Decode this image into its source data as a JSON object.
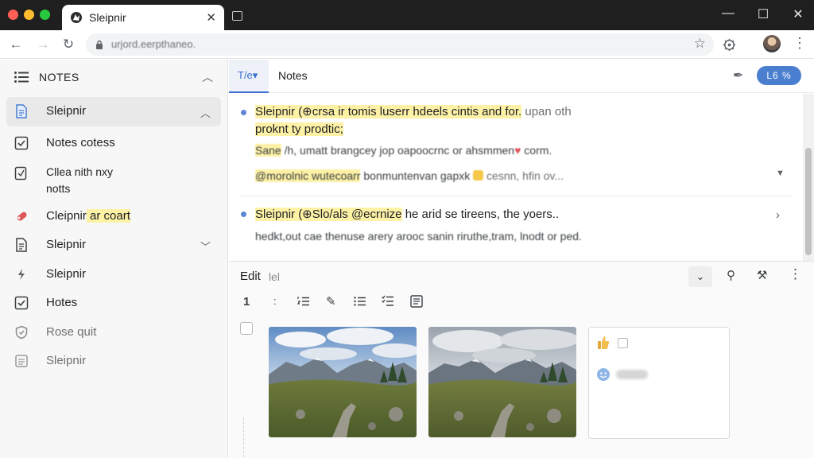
{
  "browser": {
    "tab_title": "Sleipnir",
    "tab_close": "✕",
    "url": "urjord.eerpthaneo.",
    "window_controls": [
      "—",
      "☐",
      "✕"
    ]
  },
  "sidebar": {
    "header": "NOTES",
    "items": [
      {
        "label": "Sleipnir",
        "icon": "document-icon"
      },
      {
        "label": "Notes cotess",
        "icon": "checkbox-icon"
      },
      {
        "label_line1": "Clleа nith nxy",
        "label_line2": "notts",
        "icon": "checkbox-pen-icon"
      },
      {
        "label_plain": "Cleipnir",
        "label_highlight": " ar coart",
        "icon": "tag-icon"
      },
      {
        "label": "Sleipnir",
        "icon": "document-lines-icon"
      },
      {
        "label": "Sleipnir",
        "icon": "bolt-icon"
      },
      {
        "label": "Hotes",
        "icon": "checkbox-icon"
      },
      {
        "label": "Rose quit",
        "icon": "shield-icon"
      },
      {
        "label": "Sleipnir",
        "icon": "list-icon"
      }
    ]
  },
  "main": {
    "tab_label": "T/e▾",
    "title": "Notes",
    "button_label": "L6 %"
  },
  "notes": [
    {
      "line1_hl": "Sleipnir (⊕crsa ir tomis luserr hdeels cintis and for.",
      "line1_rest": " upan oth",
      "line2_hl": "proknt ty prodtic;",
      "line3_hl": "Sane",
      "line3_rest": " /h, umatt brangcey jop oapoocrnc or ahsmmen",
      "line3_heart": "♥",
      "line3_end": " corm.",
      "line4_hl": "@morolnic wutecoarr",
      "line4_rest": " bonmuntenvan gapxk",
      "line4_end": " cesnn, hfin ov..."
    },
    {
      "line1_hl": "Sleipnir (⊕Slo/als @ecrnize",
      "line1_rest": " he arid se tireens, the yoers..",
      "line2": "hedkt,out cae thenuse arery arooc sanin riruthe,tram, lnodt or ped."
    }
  ],
  "edit": {
    "title": "Edit",
    "subtitle": "lel",
    "format_heading": "1",
    "format_colon": ":"
  }
}
